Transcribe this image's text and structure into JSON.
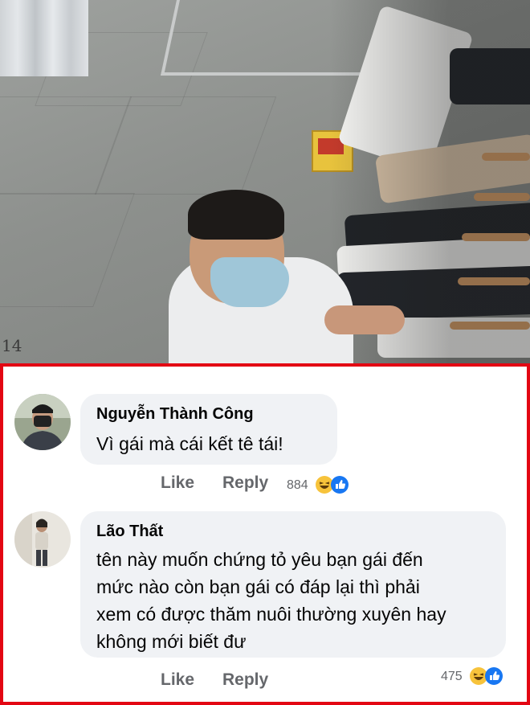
{
  "photo": {
    "timestamp_fragment": "14"
  },
  "comments": [
    {
      "author": "Nguyễn Thành Công",
      "text_lines": [
        "Vì gái mà cái kết tê tái!"
      ],
      "like_label": "Like",
      "reply_label": "Reply",
      "reaction_count": "884",
      "reactions": [
        "haha-icon",
        "like-icon"
      ]
    },
    {
      "author": "Lão Thất",
      "text_lines": [
        "tên này muốn chứng tỏ yêu bạn gái đến",
        "mức nào còn bạn gái có đáp lại thì phải",
        "xem có được thăm nuôi thường xuyên hay",
        "không mới biết đư"
      ],
      "like_label": "Like",
      "reply_label": "Reply",
      "reaction_count": "475",
      "reactions": [
        "haha-icon",
        "like-icon"
      ]
    }
  ],
  "colors": {
    "frame_border": "#e30613",
    "bubble_bg": "#f0f2f5",
    "action_text": "#65676b",
    "haha": "#f7c33b",
    "like": "#1877f2"
  }
}
